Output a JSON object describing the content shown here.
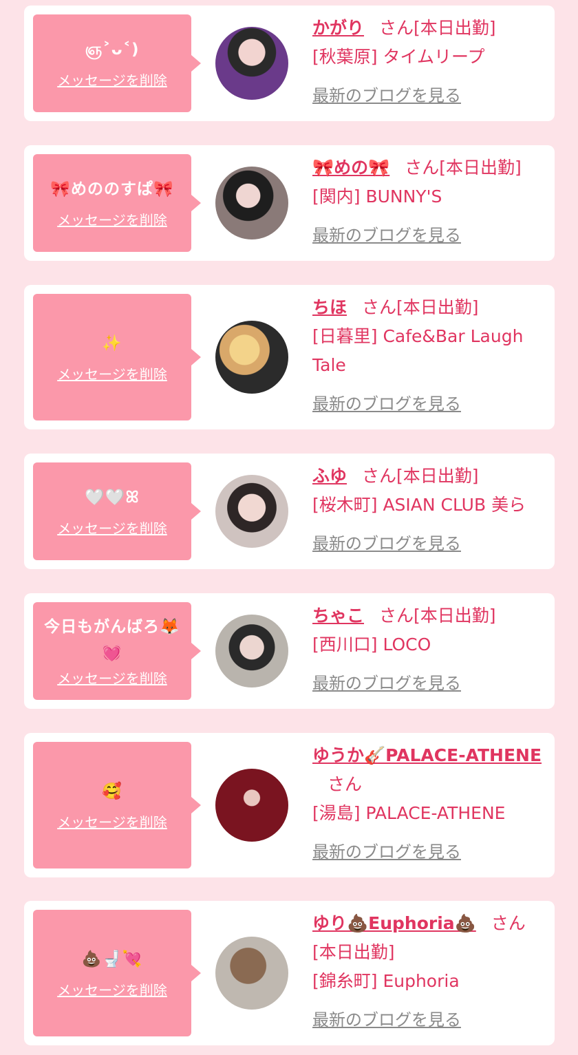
{
  "delete_label": "メッセージを削除",
  "blog_label": "最新のブログを見る",
  "san_label": "さん",
  "cards": [
    {
      "message": "ஞ˃ᴗ˂)",
      "name": "かがり",
      "status": "[本日出勤]",
      "shop": "[秋葉原] タイムリープ"
    },
    {
      "message": "🎀めののすぱ🎀",
      "name": "🎀めの🎀",
      "status": "[本日出勤]",
      "shop": "[関内] BUNNY'S"
    },
    {
      "message": "✨",
      "name": "ちほ",
      "status": "[本日出勤]",
      "shop": "[日暮里] Cafe&Bar Laugh Tale"
    },
    {
      "message": "🤍🤍ꕤ",
      "name": "ふゆ",
      "status": "[本日出勤]",
      "shop": "[桜木町] ASIAN CLUB 美ら"
    },
    {
      "message": "今日もがんばろ🦊💓",
      "name": "ちゃこ",
      "status": "[本日出勤]",
      "shop": "[西川口] LOCO"
    },
    {
      "message": "🥰",
      "name": "ゆうか🎸PALACE-ATHENE",
      "status": "",
      "shop": "[湯島] PALACE-ATHENE"
    },
    {
      "message": "💩🚽💘",
      "name": "ゆり💩Euphoria💩",
      "status": "[本日出勤]",
      "shop": "[錦糸町] Euphoria"
    }
  ],
  "colors": {
    "accent": "#e03560",
    "bubble": "#fb98aa",
    "background": "#fde3e8",
    "link_gray": "#8a8a8a"
  }
}
